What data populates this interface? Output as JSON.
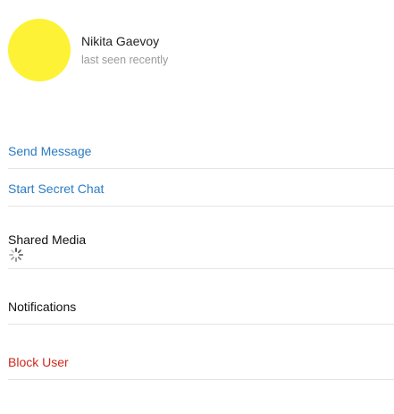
{
  "profile": {
    "name": "Nikita Gaevoy",
    "status": "last seen recently",
    "avatar_color": "#fdf235"
  },
  "actions": {
    "send_message": "Send Message",
    "start_secret_chat": "Start Secret Chat",
    "shared_media": "Shared Media",
    "notifications": "Notifications",
    "block_user": "Block User"
  },
  "colors": {
    "link": "#2b7bc4",
    "danger": "#d0281d",
    "divider": "#e4e4e4",
    "status_gray": "#9a9a9a"
  },
  "icons": {
    "shared_media_loading": "loading-spinner"
  }
}
